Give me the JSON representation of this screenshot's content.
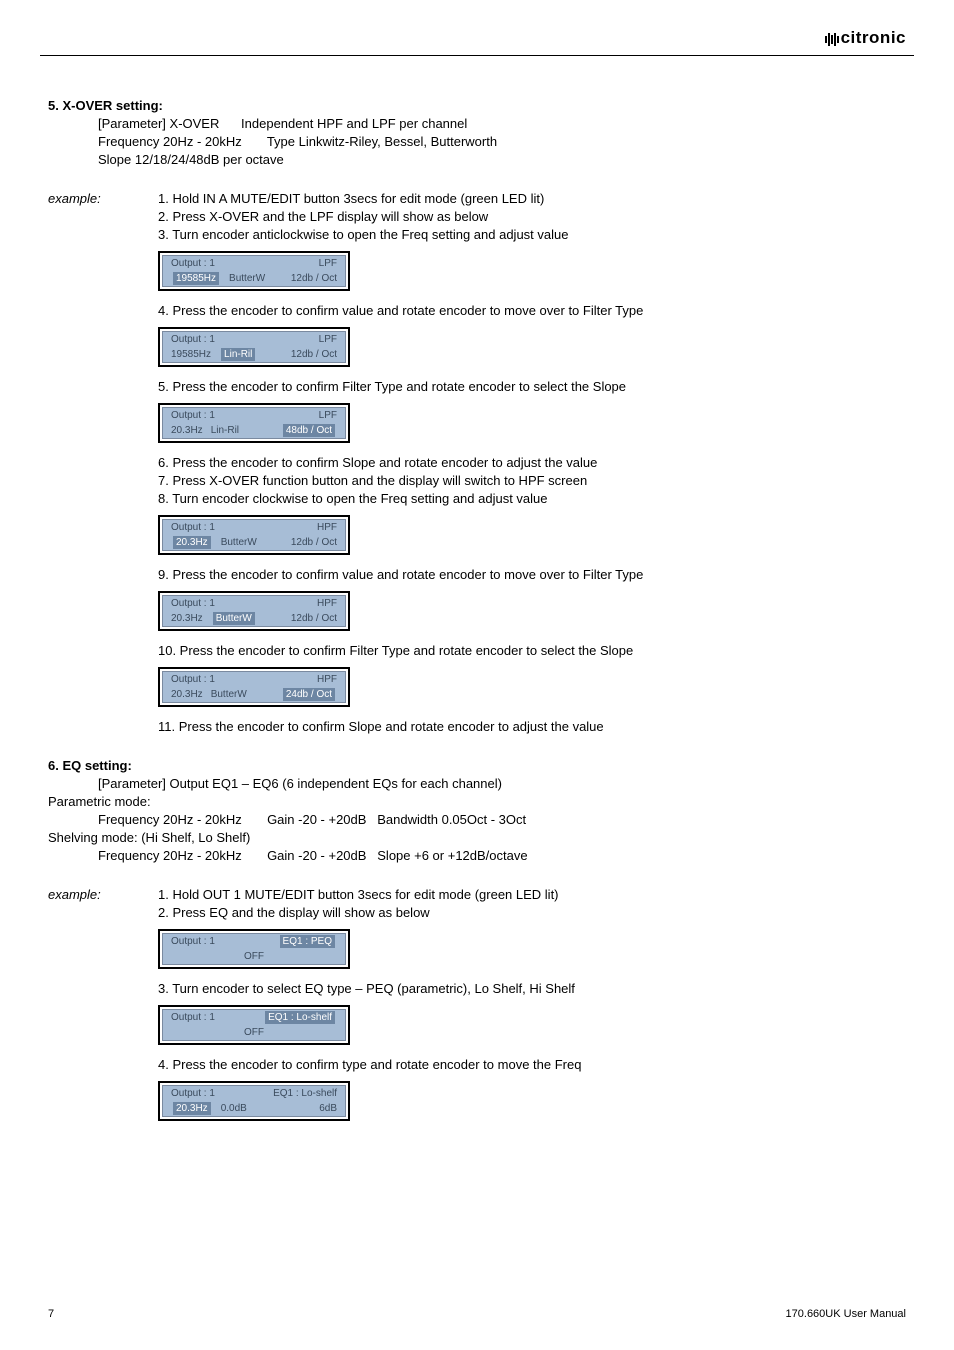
{
  "brand": "citronic",
  "section5": {
    "heading": "5. X-OVER setting:",
    "param": "[Parameter] X-OVER      Independent HPF and LPF per channel",
    "freq_line1": "Frequency 20Hz - 20kHz       Type Linkwitz-Riley, Bessel, Butterworth",
    "freq_line2": "Slope 12/18/24/48dB per octave",
    "example_label": "example:",
    "steps": {
      "s1": "1. Hold IN A MUTE/EDIT button 3secs for edit mode (green LED lit)",
      "s2": "2. Press X-OVER and the LPF display will show as below",
      "s3": "3. Turn encoder anticlockwise to open the Freq setting and adjust value",
      "s4": "4. Press the encoder to confirm value and rotate encoder to move over to Filter Type",
      "s5": "5. Press the encoder to confirm Filter Type and rotate encoder to select the Slope",
      "s6": "6. Press the encoder to confirm Slope and rotate encoder to adjust the value",
      "s7": "7. Press X-OVER function button and the display will switch to HPF screen",
      "s8": "8. Turn encoder clockwise to open the Freq setting and adjust value",
      "s9": "9. Press the encoder to confirm value and rotate encoder to move over to Filter Type",
      "s10": "10. Press the encoder to confirm Filter Type and rotate encoder to select the Slope",
      "s11": "11. Press the encoder to confirm Slope and rotate encoder to adjust the value"
    },
    "lcd": {
      "d1": {
        "r1l": "Output : 1",
        "r1r": "LPF",
        "r2a": "19585Hz",
        "r2b": "ButterW",
        "r2c": "12db / Oct",
        "hl": "r2a"
      },
      "d2": {
        "r1l": "Output : 1",
        "r1r": "LPF",
        "r2a": "19585Hz",
        "r2b": "Lin-Ril",
        "r2c": "12db / Oct",
        "hl": "r2b"
      },
      "d3": {
        "r1l": "Output : 1",
        "r1r": "LPF",
        "r2a": "20.3Hz",
        "r2b": "Lin-Ril",
        "r2c": "48db / Oct",
        "hl": "r2c"
      },
      "d4": {
        "r1l": "Output : 1",
        "r1r": "HPF",
        "r2a": "20.3Hz",
        "r2b": "ButterW",
        "r2c": "12db / Oct",
        "hl": "r2a"
      },
      "d5": {
        "r1l": "Output : 1",
        "r1r": "HPF",
        "r2a": "20.3Hz",
        "r2b": "ButterW",
        "r2c": "12db / Oct",
        "hl": "r2b"
      },
      "d6": {
        "r1l": "Output : 1",
        "r1r": "HPF",
        "r2a": "20.3Hz",
        "r2b": "ButterW",
        "r2c": "24db / Oct",
        "hl": "r2c"
      }
    }
  },
  "section6": {
    "heading": "6. EQ setting:",
    "param": "[Parameter] Output EQ1 – EQ6 (6 independent EQs for each channel)",
    "mode1": "Parametric mode:",
    "mode1_line": "Frequency 20Hz - 20kHz       Gain -20 - +20dB   Bandwidth 0.05Oct - 3Oct",
    "mode2": "Shelving mode: (Hi Shelf, Lo Shelf)",
    "mode2_line": "Frequency 20Hz - 20kHz       Gain -20 - +20dB   Slope +6 or +12dB/octave",
    "example_label": "example:",
    "steps": {
      "s1": "1. Hold OUT 1 MUTE/EDIT button 3secs for edit mode (green LED lit)",
      "s2": "2. Press EQ and the display will show as below",
      "s3": "3. Turn encoder to select EQ type – PEQ (parametric), Lo Shelf, Hi Shelf",
      "s4": "4. Press the encoder to confirm type and rotate encoder to move the Freq"
    },
    "lcd": {
      "d1": {
        "r1l": "Output : 1",
        "r1r": "EQ1 : PEQ",
        "r2a": "",
        "r2b": "OFF",
        "r2c": "",
        "hl": "r1r"
      },
      "d2": {
        "r1l": "Output : 1",
        "r1r": "EQ1 : Lo-shelf",
        "r2a": "",
        "r2b": "OFF",
        "r2c": "",
        "hl": "r1r"
      },
      "d3": {
        "r1l": "Output : 1",
        "r1r": "EQ1 : Lo-shelf",
        "r2a": "20.3Hz",
        "r2b": "0.0dB",
        "r2c": "6dB",
        "hl": "r2a"
      }
    }
  },
  "footer": {
    "left": "7",
    "right": "170.660UK User Manual"
  }
}
